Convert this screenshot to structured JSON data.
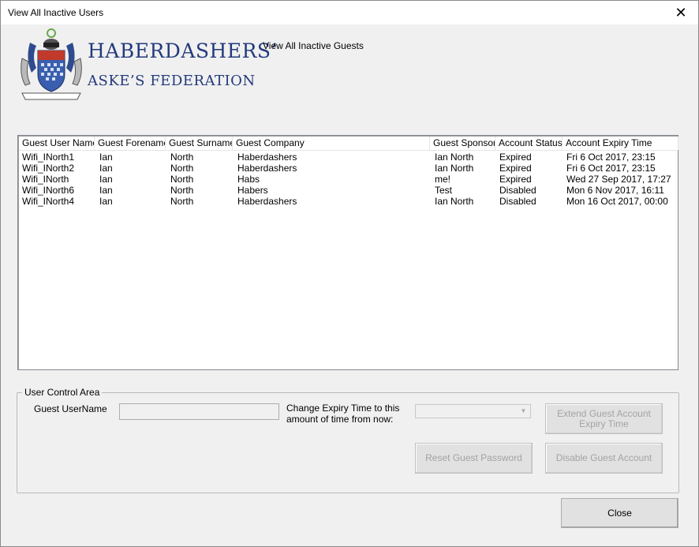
{
  "window": {
    "title": "View All Inactive Users",
    "close_glyph": "✕"
  },
  "branding": {
    "line1": "HABERDASHERS’",
    "line2": "ASKE’S FEDERATION",
    "logo_icon": "coat-of-arms-icon",
    "brand_color": "#233a7d"
  },
  "view_link": "View All Inactive Guests",
  "table": {
    "columns": [
      "Guest User Name",
      "Guest Forename",
      "Guest Surname",
      "Guest Company",
      "Guest Sponsor",
      "Account Status",
      "Account Expiry Time"
    ],
    "rows": [
      [
        "Wifi_INorth1",
        "Ian",
        "North",
        "Haberdashers",
        "Ian North",
        "Expired",
        "Fri 6 Oct 2017, 23:15"
      ],
      [
        "Wifi_INorth2",
        "Ian",
        "North",
        "Haberdashers",
        "Ian North",
        "Expired",
        "Fri 6 Oct 2017, 23:15"
      ],
      [
        "Wifi_INorth",
        "Ian",
        "North",
        "Habs",
        "me!",
        "Expired",
        "Wed 27 Sep 2017, 17:27"
      ],
      [
        "Wifi_INorth6",
        "Ian",
        "North",
        "Habers",
        "Test",
        "Disabled",
        "Mon 6 Nov 2017, 16:11"
      ],
      [
        "Wifi_INorth4",
        "Ian",
        "North",
        "Haberdashers",
        "Ian North",
        "Disabled",
        "Mon 16 Oct 2017, 00:00"
      ]
    ]
  },
  "control_area": {
    "title": "User Control Area",
    "username_label": "Guest UserName",
    "username_value": "",
    "change_expiry_label": "Change Expiry Time to this amount of time from now:",
    "expiry_selected": "",
    "extend_button": "Extend Guest Account Expiry Time",
    "reset_button": "Reset Guest Password",
    "disable_button": "Disable Guest Account"
  },
  "close_button": "Close"
}
